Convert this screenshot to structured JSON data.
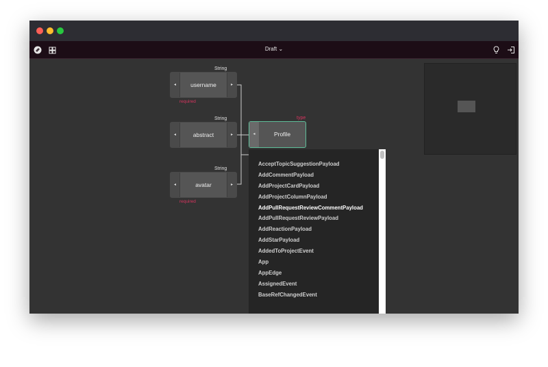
{
  "toolbar": {
    "draft_label": "Draft",
    "draft_chevron": "⌄"
  },
  "nodes": [
    {
      "label": "username",
      "type": "String",
      "required": "required"
    },
    {
      "label": "abstract",
      "type": "String",
      "required": ""
    },
    {
      "label": "avatar",
      "type": "String",
      "required": "required"
    }
  ],
  "target": {
    "label": "Profile",
    "type": "type"
  },
  "dropdown": {
    "items": [
      "AcceptTopicSuggestionPayload",
      "AddCommentPayload",
      "AddProjectCardPayload",
      "AddProjectColumnPayload",
      "AddPullRequestReviewCommentPayload",
      "AddPullRequestReviewPayload",
      "AddReactionPayload",
      "AddStarPayload",
      "AddedToProjectEvent",
      "App",
      "AppEdge",
      "AssignedEvent",
      "BaseRefChangedEvent"
    ],
    "hovered_index": 4
  },
  "icons": {
    "left_arrow": "◂",
    "right_arrow": "▸"
  }
}
